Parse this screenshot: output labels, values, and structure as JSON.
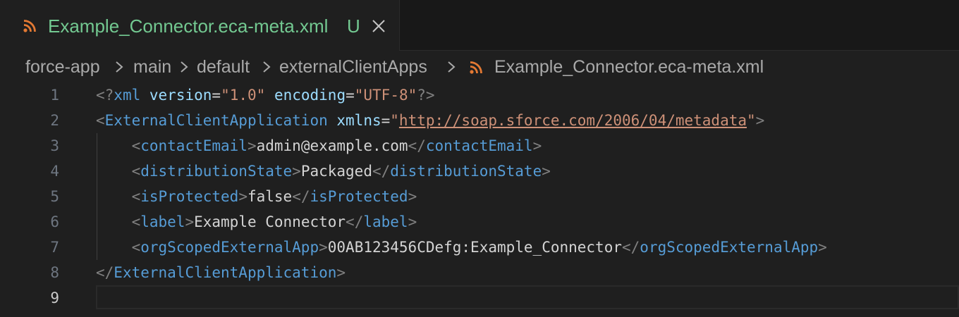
{
  "colors": {
    "tab_modified": "#73c991",
    "rss_icon": "#e37933",
    "xml_tag": "#569cd6",
    "xml_attribute": "#9cdcfe",
    "xml_string": "#ce9178",
    "xml_punctuation": "#808080"
  },
  "tab": {
    "icon": "rss-icon",
    "title": "Example_Connector.eca-meta.xml",
    "status": "U",
    "close_icon": "close-icon"
  },
  "breadcrumb": {
    "items": [
      "force-app",
      "main",
      "default",
      "externalClientApps"
    ],
    "file_icon": "rss-icon",
    "file": "Example_Connector.eca-meta.xml"
  },
  "editor": {
    "active_line": 9,
    "line_numbers": [
      "1",
      "2",
      "3",
      "4",
      "5",
      "6",
      "7",
      "8",
      "9"
    ],
    "line1": {
      "open": "<?",
      "name": "xml",
      "attr1": "version",
      "eq": "=",
      "val1": "\"1.0\"",
      "attr2": "encoding",
      "val2": "\"UTF-8\"",
      "close": "?>"
    },
    "line2": {
      "open": "<",
      "tag": "ExternalClientApplication",
      "attr": "xmlns",
      "eq": "=",
      "q": "\"",
      "url": "http://soap.sforce.com/2006/04/metadata",
      "close": ">"
    },
    "line3": {
      "tag": "contactEmail",
      "value": "admin@example.com"
    },
    "line4": {
      "tag": "distributionState",
      "value": "Packaged"
    },
    "line5": {
      "tag": "isProtected",
      "value": "false"
    },
    "line6": {
      "tag": "label",
      "value": "Example Connector"
    },
    "line7": {
      "tag": "orgScopedExternalApp",
      "value": "00AB123456CDefg:Example_Connector"
    },
    "line8": {
      "tag": "ExternalClientApplication"
    },
    "line9": ""
  }
}
